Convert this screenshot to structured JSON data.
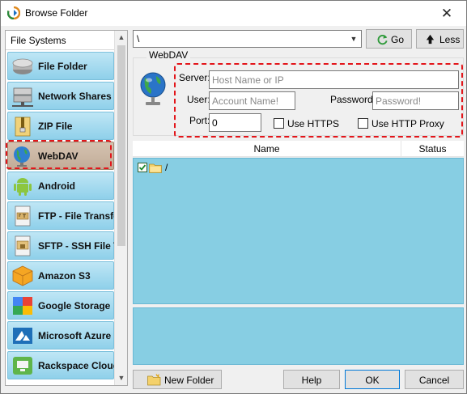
{
  "window": {
    "title": "Browse Folder",
    "close_glyph": "✕"
  },
  "file_systems": {
    "header": "File Systems",
    "items": [
      {
        "label": "File Folder",
        "icon": "file-folder-icon"
      },
      {
        "label": "Network Shares",
        "icon": "network-shares-icon"
      },
      {
        "label": "ZIP File",
        "icon": "zip-file-icon"
      },
      {
        "label": "WebDAV",
        "icon": "webdav-globe-icon",
        "selected": true
      },
      {
        "label": "Android",
        "icon": "android-icon"
      },
      {
        "label": "FTP - File Transfer",
        "icon": "ftp-icon"
      },
      {
        "label": "SFTP - SSH File Tra",
        "icon": "sftp-icon"
      },
      {
        "label": "Amazon S3",
        "icon": "amazon-s3-icon"
      },
      {
        "label": "Google Storage",
        "icon": "google-storage-icon"
      },
      {
        "label": "Microsoft Azure",
        "icon": "microsoft-azure-icon"
      },
      {
        "label": "Rackspace Cloud",
        "icon": "rackspace-cloud-icon"
      }
    ]
  },
  "path_bar": {
    "value": "\\",
    "go_label": "Go",
    "less_label": "Less"
  },
  "webdav": {
    "group_title": "WebDAV",
    "server_label": "Server:",
    "server_placeholder": "Host Name or IP",
    "user_label": "User:",
    "user_placeholder": "Account Name!",
    "password_label": "Password:",
    "password_placeholder": "Password!",
    "port_label": "Port:",
    "port_value": "0",
    "https_label": "Use HTTPS",
    "https_checked": false,
    "proxy_label": "Use HTTP Proxy",
    "proxy_checked": false
  },
  "list": {
    "columns": [
      "Name",
      "Status"
    ],
    "rows": [
      {
        "name": "/",
        "checked": true
      }
    ]
  },
  "footer": {
    "new_folder_label": "New Folder",
    "help_label": "Help",
    "ok_label": "OK",
    "cancel_label": "Cancel"
  },
  "colors": {
    "list_background": "#87cee3",
    "item_gradient": "#8fd0ea",
    "selected_item": "#c1ac98",
    "annotation_red": "#e3151a"
  }
}
